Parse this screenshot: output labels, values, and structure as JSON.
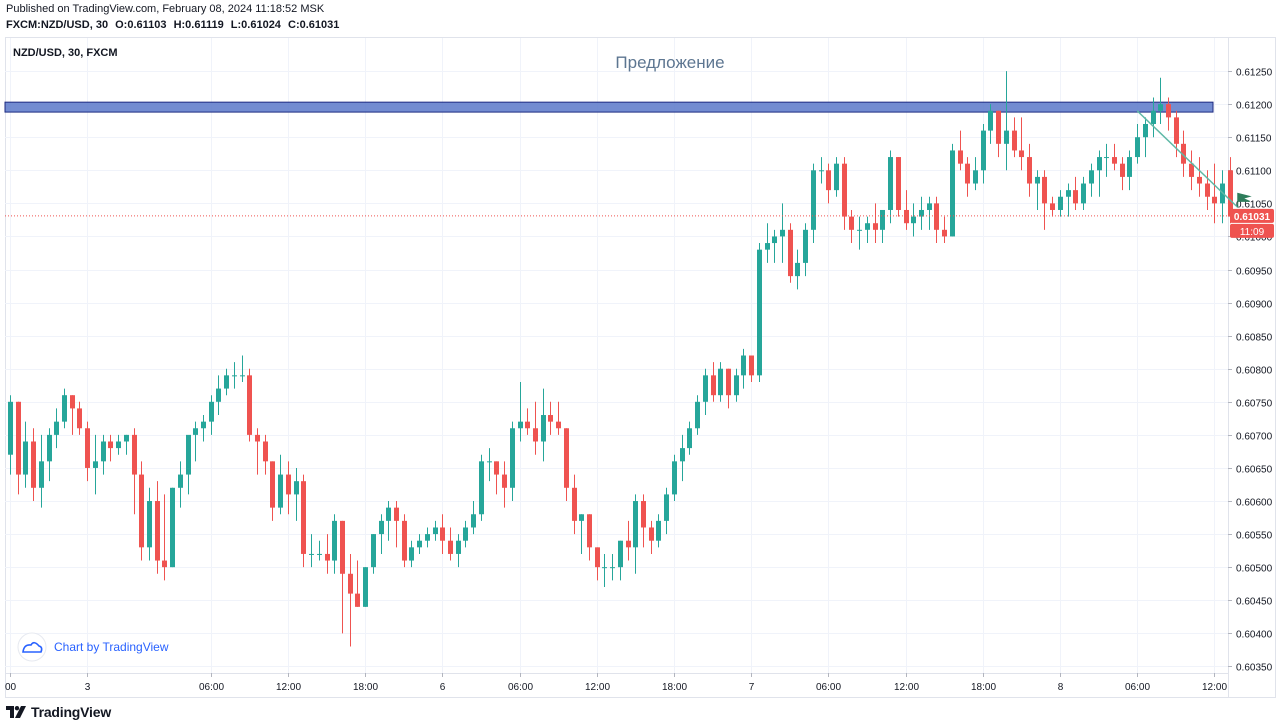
{
  "header": {
    "published": "Published on TradingView.com, February 08, 2024 11:18:52 MSK",
    "symbol": "FXCM:NZD/USD, 30",
    "open": "O:0.61103",
    "high": "H:0.61119",
    "low": "L:0.61024",
    "close": "C:0.61031"
  },
  "legend": {
    "symbol_label": "NZD/USD, 30, FXCM"
  },
  "watermark": {
    "label": "Chart by TradingView"
  },
  "footer": {
    "brand": "TradingView"
  },
  "colors": {
    "up": "#26a69a",
    "down": "#ef5350",
    "grid": "#f0f3fa",
    "zone_fill": "#5b78c9",
    "zone_border": "#1c2a80",
    "price_badge": "#ef5350",
    "title": "#5d7691",
    "trendline": "#5fb8a6"
  },
  "chart_data": {
    "type": "candlestick",
    "title": "Предложение",
    "ylim": [
      0.6034,
      0.613
    ],
    "y_ticks": [
      "0.61250",
      "0.61200",
      "0.61150",
      "0.61100",
      "0.61050",
      "0.61000",
      "0.60950",
      "0.60900",
      "0.60850",
      "0.60800",
      "0.60750",
      "0.60700",
      "0.60650",
      "0.60600",
      "0.60550",
      "0.60500",
      "0.60450",
      "0.60400",
      "0.60350"
    ],
    "x_ticks": [
      {
        "label": "00",
        "i": 0
      },
      {
        "label": "3",
        "i": 10
      },
      {
        "label": "06:00",
        "i": 26
      },
      {
        "label": "12:00",
        "i": 36
      },
      {
        "label": "18:00",
        "i": 46
      },
      {
        "label": "6",
        "i": 56
      },
      {
        "label": "06:00",
        "i": 66
      },
      {
        "label": "12:00",
        "i": 76
      },
      {
        "label": "18:00",
        "i": 86
      },
      {
        "label": "7",
        "i": 96
      },
      {
        "label": "06:00",
        "i": 106
      },
      {
        "label": "12:00",
        "i": 116
      },
      {
        "label": "18:00",
        "i": 126
      },
      {
        "label": "8",
        "i": 136
      },
      {
        "label": "06:00",
        "i": 146
      },
      {
        "label": "12:00",
        "i": 156
      }
    ],
    "candles": [
      [
        0.6067,
        0.6076,
        0.6064,
        0.6075
      ],
      [
        0.6075,
        0.6075,
        0.6061,
        0.6064
      ],
      [
        0.6064,
        0.6072,
        0.6062,
        0.6069
      ],
      [
        0.6069,
        0.6071,
        0.606,
        0.6062
      ],
      [
        0.6062,
        0.607,
        0.6059,
        0.6066
      ],
      [
        0.6066,
        0.6071,
        0.6063,
        0.607
      ],
      [
        0.607,
        0.6074,
        0.6068,
        0.6072
      ],
      [
        0.6072,
        0.6077,
        0.6071,
        0.6076
      ],
      [
        0.6076,
        0.6076,
        0.607,
        0.6074
      ],
      [
        0.6074,
        0.6075,
        0.607,
        0.6071
      ],
      [
        0.6071,
        0.6072,
        0.6063,
        0.6065
      ],
      [
        0.6065,
        0.607,
        0.6061,
        0.6066
      ],
      [
        0.6066,
        0.607,
        0.6064,
        0.6069
      ],
      [
        0.6069,
        0.607,
        0.6066,
        0.6068
      ],
      [
        0.6068,
        0.607,
        0.6067,
        0.6069
      ],
      [
        0.6069,
        0.607,
        0.6067,
        0.607
      ],
      [
        0.607,
        0.6071,
        0.6058,
        0.6064
      ],
      [
        0.6064,
        0.6066,
        0.6051,
        0.6053
      ],
      [
        0.6053,
        0.6062,
        0.6051,
        0.606
      ],
      [
        0.606,
        0.6063,
        0.6049,
        0.6051
      ],
      [
        0.6051,
        0.6061,
        0.6048,
        0.605
      ],
      [
        0.605,
        0.6062,
        0.605,
        0.6062
      ],
      [
        0.6062,
        0.6066,
        0.6059,
        0.6064
      ],
      [
        0.6064,
        0.6069,
        0.6061,
        0.607
      ],
      [
        0.607,
        0.6072,
        0.6066,
        0.6071
      ],
      [
        0.6071,
        0.6073,
        0.6069,
        0.6072
      ],
      [
        0.6072,
        0.6076,
        0.607,
        0.6075
      ],
      [
        0.6075,
        0.6079,
        0.6073,
        0.6077
      ],
      [
        0.6077,
        0.608,
        0.6076,
        0.6079
      ],
      [
        0.6079,
        0.6081,
        0.6077,
        0.6079
      ],
      [
        0.6079,
        0.6082,
        0.6078,
        0.6079
      ],
      [
        0.6079,
        0.608,
        0.6069,
        0.607
      ],
      [
        0.607,
        0.6071,
        0.6064,
        0.6069
      ],
      [
        0.6069,
        0.607,
        0.6064,
        0.6066
      ],
      [
        0.6066,
        0.6066,
        0.6057,
        0.6059
      ],
      [
        0.6059,
        0.6067,
        0.6058,
        0.6064
      ],
      [
        0.6064,
        0.6066,
        0.6058,
        0.6061
      ],
      [
        0.6061,
        0.6065,
        0.6057,
        0.6063
      ],
      [
        0.6063,
        0.6064,
        0.605,
        0.6052
      ],
      [
        0.6052,
        0.6055,
        0.605,
        0.6052
      ],
      [
        0.6052,
        0.6054,
        0.6051,
        0.6052
      ],
      [
        0.6052,
        0.6055,
        0.6049,
        0.6051
      ],
      [
        0.6051,
        0.6058,
        0.6049,
        0.6057
      ],
      [
        0.6057,
        0.6057,
        0.604,
        0.6049
      ],
      [
        0.6049,
        0.6052,
        0.6038,
        0.6046
      ],
      [
        0.6046,
        0.6051,
        0.6044,
        0.6044
      ],
      [
        0.6044,
        0.605,
        0.6044,
        0.605
      ],
      [
        0.605,
        0.6055,
        0.6049,
        0.6055
      ],
      [
        0.6055,
        0.6058,
        0.6052,
        0.6057
      ],
      [
        0.6057,
        0.606,
        0.6054,
        0.6059
      ],
      [
        0.6059,
        0.606,
        0.6053,
        0.6057
      ],
      [
        0.6057,
        0.6058,
        0.605,
        0.6051
      ],
      [
        0.6051,
        0.6054,
        0.605,
        0.6053
      ],
      [
        0.6053,
        0.6055,
        0.6052,
        0.6054
      ],
      [
        0.6054,
        0.6056,
        0.6053,
        0.6055
      ],
      [
        0.6055,
        0.6057,
        0.6054,
        0.6056
      ],
      [
        0.6056,
        0.6058,
        0.6052,
        0.6054
      ],
      [
        0.6054,
        0.6056,
        0.6051,
        0.6052
      ],
      [
        0.6052,
        0.6055,
        0.605,
        0.6054
      ],
      [
        0.6054,
        0.6057,
        0.6053,
        0.6056
      ],
      [
        0.6056,
        0.606,
        0.6055,
        0.6058
      ],
      [
        0.6058,
        0.6067,
        0.6057,
        0.6066
      ],
      [
        0.6066,
        0.6068,
        0.6063,
        0.6066
      ],
      [
        0.6066,
        0.6066,
        0.6061,
        0.6064
      ],
      [
        0.6064,
        0.6066,
        0.6059,
        0.6062
      ],
      [
        0.6062,
        0.6072,
        0.606,
        0.6071
      ],
      [
        0.6071,
        0.6078,
        0.6069,
        0.6072
      ],
      [
        0.6072,
        0.6074,
        0.607,
        0.6071
      ],
      [
        0.6071,
        0.6075,
        0.6067,
        0.6069
      ],
      [
        0.6069,
        0.6077,
        0.6066,
        0.6073
      ],
      [
        0.6073,
        0.6075,
        0.607,
        0.6072
      ],
      [
        0.6072,
        0.6075,
        0.607,
        0.6071
      ],
      [
        0.6071,
        0.6071,
        0.606,
        0.6062
      ],
      [
        0.6062,
        0.6064,
        0.6055,
        0.6057
      ],
      [
        0.6057,
        0.6058,
        0.6052,
        0.6058
      ],
      [
        0.6058,
        0.6058,
        0.6051,
        0.6053
      ],
      [
        0.6053,
        0.6053,
        0.6048,
        0.605
      ],
      [
        0.605,
        0.6052,
        0.6047,
        0.605
      ],
      [
        0.605,
        0.6052,
        0.6048,
        0.605
      ],
      [
        0.605,
        0.6054,
        0.6048,
        0.6054
      ],
      [
        0.6054,
        0.6057,
        0.6051,
        0.6053
      ],
      [
        0.6053,
        0.6061,
        0.6049,
        0.606
      ],
      [
        0.606,
        0.6061,
        0.6053,
        0.6056
      ],
      [
        0.6056,
        0.6057,
        0.6052,
        0.6054
      ],
      [
        0.6054,
        0.6058,
        0.6053,
        0.6057
      ],
      [
        0.6057,
        0.6062,
        0.6055,
        0.6061
      ],
      [
        0.6061,
        0.6067,
        0.606,
        0.6066
      ],
      [
        0.6066,
        0.607,
        0.6063,
        0.6068
      ],
      [
        0.6068,
        0.6072,
        0.6067,
        0.6071
      ],
      [
        0.6071,
        0.6076,
        0.607,
        0.6075
      ],
      [
        0.6075,
        0.608,
        0.6073,
        0.6079
      ],
      [
        0.6079,
        0.6081,
        0.6075,
        0.6076
      ],
      [
        0.6076,
        0.6081,
        0.6075,
        0.608
      ],
      [
        0.608,
        0.608,
        0.6074,
        0.6076
      ],
      [
        0.6076,
        0.608,
        0.6075,
        0.6079
      ],
      [
        0.6079,
        0.6083,
        0.6077,
        0.6082
      ],
      [
        0.6082,
        0.6082,
        0.6078,
        0.6079
      ],
      [
        0.6079,
        0.6099,
        0.6078,
        0.6098
      ],
      [
        0.6098,
        0.6102,
        0.6096,
        0.6099
      ],
      [
        0.6099,
        0.6101,
        0.6096,
        0.61
      ],
      [
        0.61,
        0.6105,
        0.6096,
        0.6101
      ],
      [
        0.6101,
        0.6102,
        0.6093,
        0.6094
      ],
      [
        0.6094,
        0.6098,
        0.6092,
        0.6096
      ],
      [
        0.6096,
        0.6102,
        0.6094,
        0.6101
      ],
      [
        0.6101,
        0.6111,
        0.6099,
        0.611
      ],
      [
        0.611,
        0.6112,
        0.6108,
        0.611
      ],
      [
        0.611,
        0.6111,
        0.6105,
        0.6107
      ],
      [
        0.6107,
        0.6112,
        0.6106,
        0.6111
      ],
      [
        0.6111,
        0.6112,
        0.6101,
        0.6103
      ],
      [
        0.6103,
        0.6104,
        0.6099,
        0.6101
      ],
      [
        0.6101,
        0.6103,
        0.6098,
        0.6101
      ],
      [
        0.6101,
        0.6103,
        0.6099,
        0.6102
      ],
      [
        0.6102,
        0.6105,
        0.6099,
        0.6101
      ],
      [
        0.6101,
        0.6104,
        0.6099,
        0.6104
      ],
      [
        0.6104,
        0.6113,
        0.6102,
        0.6112
      ],
      [
        0.6112,
        0.6112,
        0.6103,
        0.6104
      ],
      [
        0.6104,
        0.6107,
        0.6101,
        0.6102
      ],
      [
        0.6102,
        0.6105,
        0.61,
        0.6103
      ],
      [
        0.6103,
        0.6106,
        0.6101,
        0.6104
      ],
      [
        0.6104,
        0.6106,
        0.6101,
        0.6105
      ],
      [
        0.6105,
        0.6106,
        0.6099,
        0.6101
      ],
      [
        0.6101,
        0.6103,
        0.6099,
        0.61
      ],
      [
        0.61,
        0.6114,
        0.61,
        0.6113
      ],
      [
        0.6113,
        0.6116,
        0.611,
        0.6111
      ],
      [
        0.6111,
        0.6112,
        0.6106,
        0.6108
      ],
      [
        0.6108,
        0.6112,
        0.6107,
        0.611
      ],
      [
        0.611,
        0.6117,
        0.6108,
        0.6116
      ],
      [
        0.6116,
        0.612,
        0.6114,
        0.6119
      ],
      [
        0.6119,
        0.6119,
        0.6112,
        0.6114
      ],
      [
        0.6114,
        0.6125,
        0.611,
        0.6116
      ],
      [
        0.6116,
        0.6118,
        0.6112,
        0.6113
      ],
      [
        0.6113,
        0.6118,
        0.611,
        0.6112
      ],
      [
        0.6112,
        0.6114,
        0.6106,
        0.6108
      ],
      [
        0.6108,
        0.611,
        0.6104,
        0.6109
      ],
      [
        0.6109,
        0.611,
        0.6101,
        0.6105
      ],
      [
        0.6105,
        0.6106,
        0.6103,
        0.6104
      ],
      [
        0.6104,
        0.6107,
        0.6103,
        0.6106
      ],
      [
        0.6106,
        0.6108,
        0.6103,
        0.6107
      ],
      [
        0.6107,
        0.6109,
        0.6104,
        0.6105
      ],
      [
        0.6105,
        0.6109,
        0.6104,
        0.6108
      ],
      [
        0.6108,
        0.6111,
        0.6106,
        0.611
      ],
      [
        0.611,
        0.6113,
        0.6106,
        0.6112
      ],
      [
        0.6112,
        0.6114,
        0.6109,
        0.6112
      ],
      [
        0.6112,
        0.6114,
        0.611,
        0.6111
      ],
      [
        0.6111,
        0.6112,
        0.6107,
        0.6109
      ],
      [
        0.6109,
        0.6113,
        0.6107,
        0.6112
      ],
      [
        0.6112,
        0.6117,
        0.6111,
        0.6115
      ],
      [
        0.6115,
        0.6118,
        0.6112,
        0.6117
      ],
      [
        0.6117,
        0.6121,
        0.6115,
        0.6119
      ],
      [
        0.6119,
        0.6124,
        0.6117,
        0.612
      ],
      [
        0.612,
        0.6121,
        0.6116,
        0.6118
      ],
      [
        0.6118,
        0.6119,
        0.6112,
        0.6114
      ],
      [
        0.6114,
        0.6116,
        0.6109,
        0.6111
      ],
      [
        0.6111,
        0.6113,
        0.6107,
        0.6109
      ],
      [
        0.6109,
        0.6112,
        0.6106,
        0.6108
      ],
      [
        0.6108,
        0.611,
        0.6104,
        0.6106
      ],
      [
        0.6106,
        0.6111,
        0.6102,
        0.6105
      ],
      [
        0.6105,
        0.611,
        0.6102,
        0.6108
      ],
      [
        0.611,
        0.6112,
        0.6102,
        0.6103
      ]
    ],
    "annotations": {
      "resistance_zone": [
        0.61188,
        0.61203
      ],
      "last_price": "0.61031",
      "countdown": "11:09",
      "trendline": [
        [
          146,
          0.6119
        ],
        [
          158,
          0.6105
        ]
      ]
    }
  }
}
